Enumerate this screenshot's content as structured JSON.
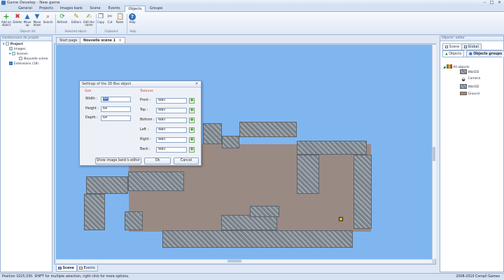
{
  "window": {
    "title": "Game Develop - New game"
  },
  "ribbon_tabs": [
    "General",
    "Projects",
    "Images bank",
    "Scene",
    "Events",
    "Objects",
    "Groupe"
  ],
  "ribbon": {
    "groups": {
      "objects_list": "Objects list",
      "selected_object": "Selected object",
      "clipboard": "Clipboard",
      "help": "Help"
    },
    "buttons": {
      "add": "Add an object",
      "delete": "Delete",
      "move_up": "Move up",
      "move_down": "Move down",
      "search": "Search",
      "refresh": "Refresh",
      "editors": "Editors",
      "edit_name": "Edit the name",
      "copy": "Copy",
      "cut": "Cut",
      "paste": "Paste",
      "help": "Help"
    }
  },
  "project_panel": {
    "header": "Gestionnaire de projets",
    "tree": {
      "project": "Project",
      "images": "Images",
      "scenes": "Scenes",
      "new_scene": "Nouvelle scène",
      "extensions": "Extensions (18)"
    }
  },
  "doc_tabs": {
    "start": "Start page",
    "scene": "Nouvelle scène 1"
  },
  "object_editor": {
    "header": "Objects' editor",
    "scope_tabs": {
      "scene": "Scene",
      "global": "Global"
    },
    "sub_tabs": {
      "objects": "Objects",
      "groups": "Objects groups"
    },
    "root": "All objects",
    "items": [
      "Wall2D",
      "Camera",
      "Wall3D",
      "Ground"
    ]
  },
  "dialog": {
    "title": "Settings of the 3D Box object",
    "size_section": "Size",
    "textures_section": "Textures",
    "width_label": "Width :",
    "width_value": "64",
    "height_label": "Height :",
    "height_value": "64",
    "depth_label": "Depth :",
    "depth_value": "64",
    "front_label": "Front :",
    "front_value": "Wall",
    "top_label": "Top :",
    "top_value": "Wall",
    "bottom_label": "Bottom :",
    "bottom_value": "Wall",
    "left_label": "Left :",
    "left_value": "Wall",
    "right_label": "Right :",
    "right_value": "Wall",
    "back_label": "Back :",
    "back_value": "Wall",
    "show_bank": "Show image bank's editor",
    "ok": "Ok",
    "cancel": "Cancel"
  },
  "bottom_tabs": {
    "scene": "Scene",
    "events": "Events"
  },
  "status": {
    "left": "Position 1025;330. SHIFT for multiple selection, right click for more options.",
    "right": "2008-2010 Compil Games"
  },
  "colors": {
    "sky": "#7fb6f0",
    "floor": "#9a8a84",
    "accent": "#2f6fc2"
  }
}
